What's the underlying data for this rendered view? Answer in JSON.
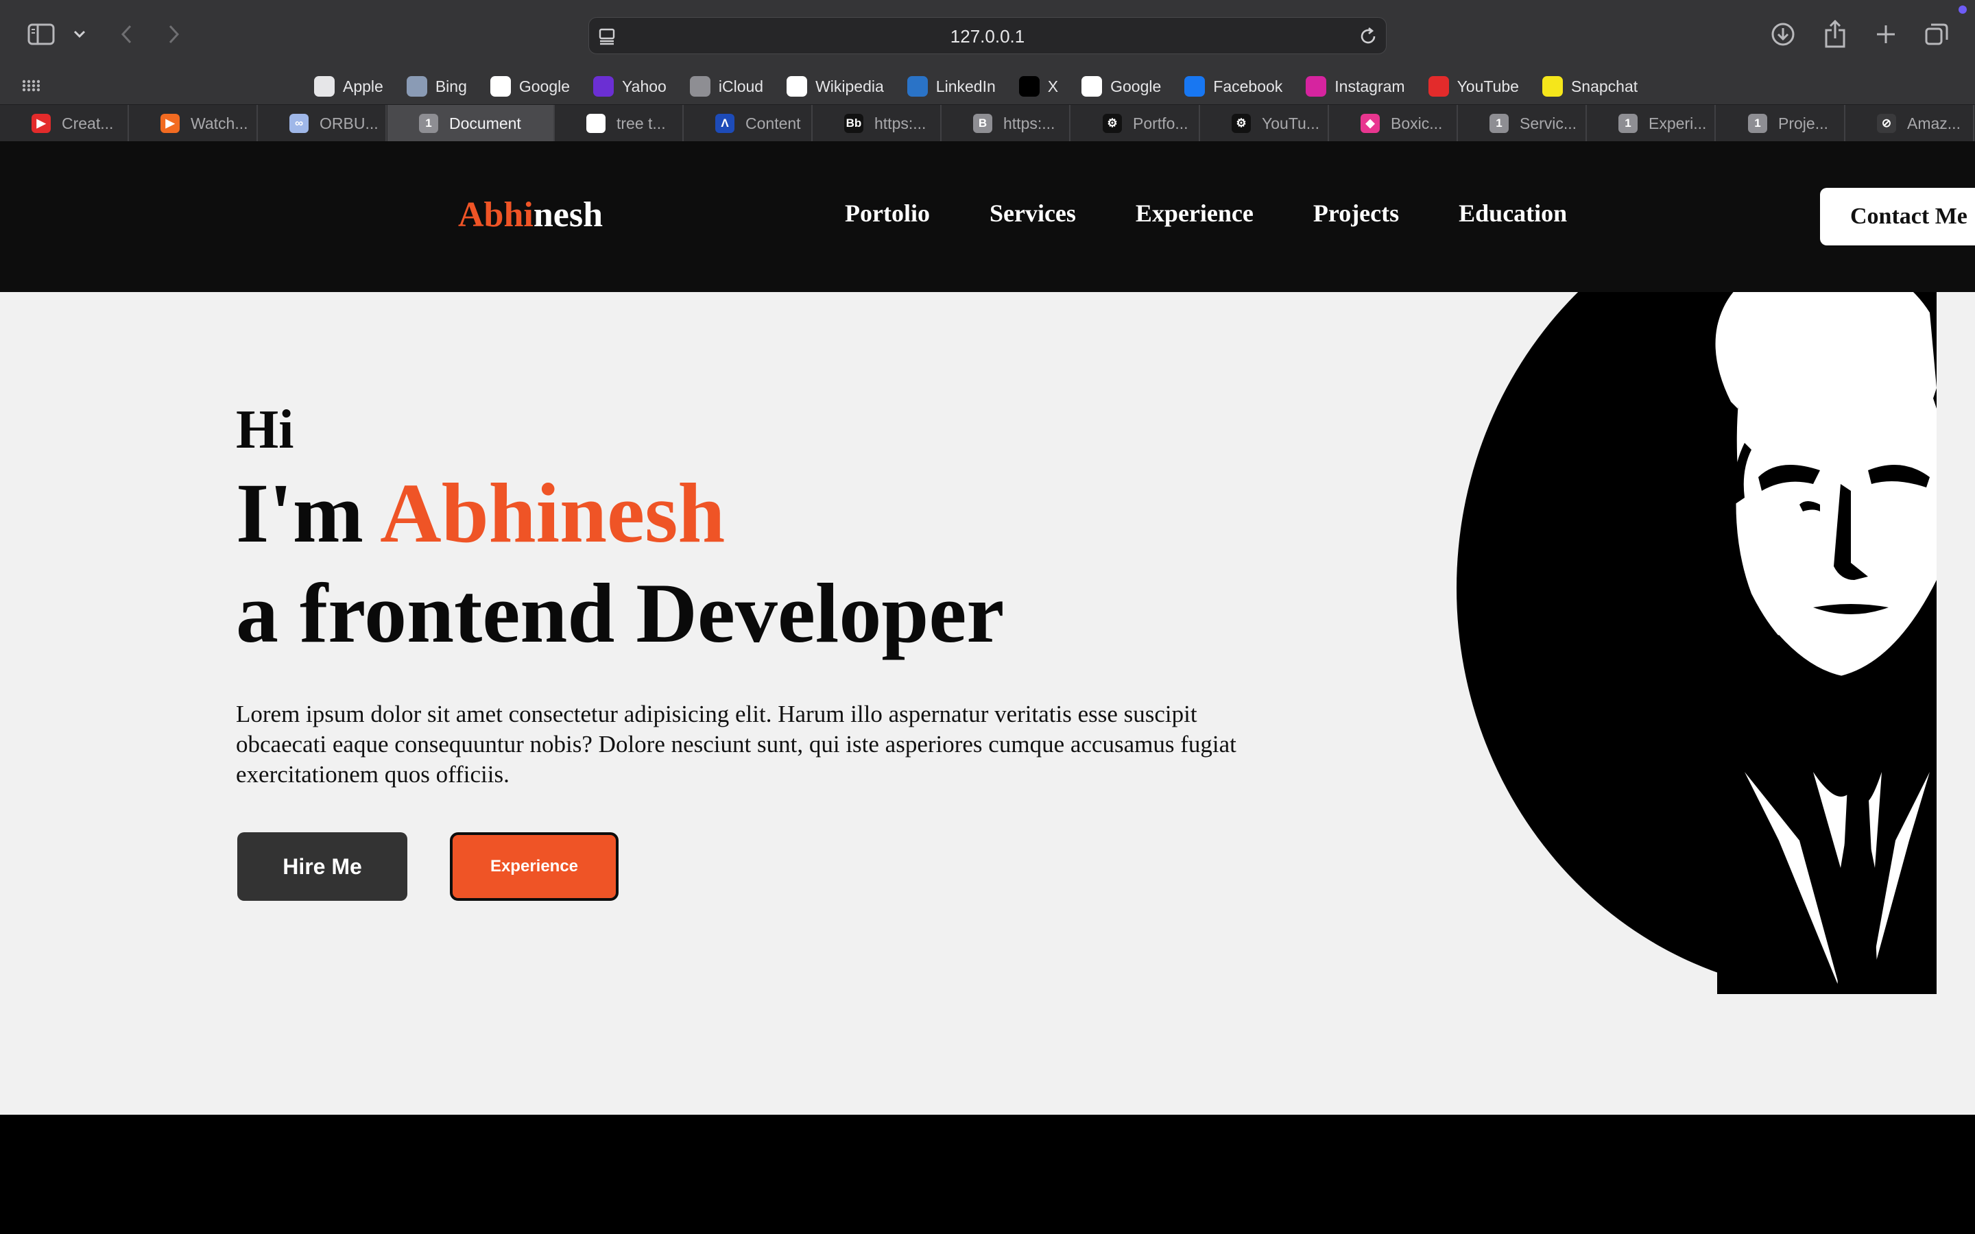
{
  "browser": {
    "url": "127.0.0.1",
    "favorites": [
      {
        "label": "Apple",
        "icon": "apple-icon",
        "color": "#e6e6e8"
      },
      {
        "label": "Bing",
        "icon": "bing-icon",
        "color": "#8a9bb5"
      },
      {
        "label": "Google",
        "icon": "google-icon",
        "color": "#ffffff"
      },
      {
        "label": "Yahoo",
        "icon": "yahoo-icon",
        "color": "#6b2fd3"
      },
      {
        "label": "iCloud",
        "icon": "apple-icon",
        "color": "#8e8e93"
      },
      {
        "label": "Wikipedia",
        "icon": "wikipedia-icon",
        "color": "#ffffff"
      },
      {
        "label": "LinkedIn",
        "icon": "linkedin-icon",
        "color": "#2a73c7"
      },
      {
        "label": "X",
        "icon": "x-icon",
        "color": "#000000"
      },
      {
        "label": "Google",
        "icon": "google-icon",
        "color": "#ffffff"
      },
      {
        "label": "Facebook",
        "icon": "facebook-icon",
        "color": "#1877f2"
      },
      {
        "label": "Instagram",
        "icon": "instagram-icon",
        "color": "#d6249f"
      },
      {
        "label": "YouTube",
        "icon": "youtube-icon",
        "color": "#e32b2b"
      },
      {
        "label": "Snapchat",
        "icon": "snapchat-icon",
        "color": "#f5e61b"
      }
    ],
    "tabs": [
      {
        "label": "Creat...",
        "icon": "youtube-icon",
        "color": "#e32b2b",
        "glyph": "▶",
        "active": false
      },
      {
        "label": "Watch...",
        "icon": "play-icon",
        "color": "#f26b21",
        "glyph": "▶",
        "active": false
      },
      {
        "label": "ORBU...",
        "icon": "link-icon",
        "color": "#9fb7e8",
        "glyph": "∞",
        "active": false
      },
      {
        "label": "Document",
        "icon": "page-number-icon",
        "color": "#8e8e93",
        "glyph": "1",
        "active": true
      },
      {
        "label": "tree t...",
        "icon": "google-icon",
        "color": "#ffffff",
        "glyph": "G",
        "active": false
      },
      {
        "label": "Content",
        "icon": "content-icon",
        "color": "#1d4bb8",
        "glyph": "Λ",
        "active": false
      },
      {
        "label": "https:...",
        "icon": "bb-icon",
        "color": "#111111",
        "glyph": "Bb",
        "active": false
      },
      {
        "label": "https:...",
        "icon": "b-icon",
        "color": "#8e8e93",
        "glyph": "B",
        "active": false
      },
      {
        "label": "Portfo...",
        "icon": "openai-icon",
        "color": "#111111",
        "glyph": "⚙",
        "active": false
      },
      {
        "label": "YouTu...",
        "icon": "openai-icon",
        "color": "#111111",
        "glyph": "⚙",
        "active": false
      },
      {
        "label": "Boxic...",
        "icon": "boxicons-icon",
        "color": "#e8368f",
        "glyph": "◆",
        "active": false
      },
      {
        "label": "Servic...",
        "icon": "page-number-icon",
        "color": "#8e8e93",
        "glyph": "1",
        "active": false
      },
      {
        "label": "Experi...",
        "icon": "page-number-icon",
        "color": "#8e8e93",
        "glyph": "1",
        "active": false
      },
      {
        "label": "Proje...",
        "icon": "page-number-icon",
        "color": "#8e8e93",
        "glyph": "1",
        "active": false
      },
      {
        "label": "Amaz...",
        "icon": "compass-icon",
        "color": "#3a3a3c",
        "glyph": "⊘",
        "active": false
      }
    ]
  },
  "site": {
    "logo_accent": "Abhi",
    "logo_rest": "nesh",
    "nav": [
      "Portolio",
      "Services",
      "Experience",
      "Projects",
      "Education"
    ],
    "contact_label": "Contact Me",
    "hero": {
      "greeting": "Hi",
      "intro": "I'm ",
      "name": "Abhinesh",
      "role": "a frontend Developer",
      "description": "Lorem ipsum dolor sit amet consectetur adipisicing elit. Harum illo aspernatur veritatis esse suscipit obcaecati eaque consequuntur nobis? Dolore nesciunt sunt, qui iste asperiores cumque accusamus fugiat exercitationem quos officiis.",
      "hire_label": "Hire Me",
      "experience_label": "Experience"
    },
    "colors": {
      "accent": "#ef5426",
      "header_bg": "#0d0d0d",
      "hero_bg": "#f1f1f1"
    }
  }
}
